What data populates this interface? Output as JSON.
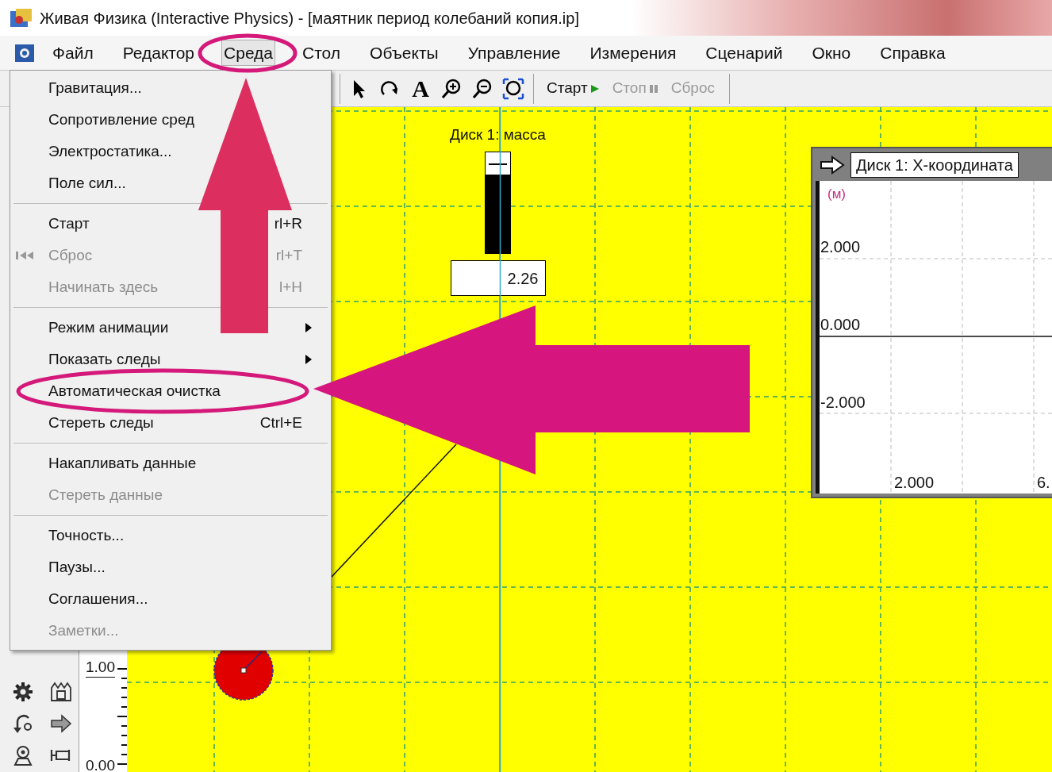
{
  "window": {
    "title": "Живая Физика (Interactive Physics) - [маятник период колебаний копия.ip]"
  },
  "menu_bar": [
    {
      "label": "Файл",
      "selected": false
    },
    {
      "label": "Редактор",
      "selected": false
    },
    {
      "label": "Среда",
      "selected": true
    },
    {
      "label": "Стол",
      "selected": false
    },
    {
      "label": "Объекты",
      "selected": false
    },
    {
      "label": "Управление",
      "selected": false
    },
    {
      "label": "Измерения",
      "selected": false
    },
    {
      "label": "Сценарий",
      "selected": false
    },
    {
      "label": "Окно",
      "selected": false
    },
    {
      "label": "Справка",
      "selected": false
    }
  ],
  "toolbar": {
    "tools": [
      {
        "kind": "arrow"
      },
      {
        "kind": "rotate"
      },
      {
        "kind": "text",
        "glyph": "A"
      },
      {
        "kind": "zoom-in"
      },
      {
        "kind": "zoom-out"
      },
      {
        "kind": "zoom-fit"
      }
    ],
    "run_buttons": [
      {
        "label": "Старт",
        "kind": "start",
        "disabled": false
      },
      {
        "label": "Стоп",
        "kind": "stop",
        "disabled": true
      },
      {
        "label": "Сброс",
        "kind": "reset",
        "disabled": true
      }
    ]
  },
  "dropdown": {
    "groups": [
      [
        {
          "label": "Гравитация...",
          "disabled": false
        },
        {
          "label": "Сопротивление сред",
          "disabled": false
        },
        {
          "label": "Электростатика...",
          "disabled": false
        },
        {
          "label": "Поле сил...",
          "disabled": false
        }
      ],
      [
        {
          "label": "Старт",
          "shortcut": "rl+R",
          "disabled": false
        },
        {
          "label": "Сброс",
          "shortcut": "rl+T",
          "disabled": true
        },
        {
          "label": "Начинать здесь",
          "shortcut": "l+H",
          "disabled": true
        }
      ],
      [
        {
          "label": "Режим анимации",
          "disabled": false,
          "submenu": true
        },
        {
          "label": "Показать следы",
          "disabled": false,
          "submenu": true
        },
        {
          "label": "Автоматическая очистка",
          "disabled": false
        },
        {
          "label": "Стереть следы",
          "shortcut": "Ctrl+E",
          "disabled": false
        }
      ],
      [
        {
          "label": "Накапливать данные",
          "disabled": false
        },
        {
          "label": "Стереть данные",
          "disabled": true
        }
      ],
      [
        {
          "label": "Точность...",
          "disabled": false
        },
        {
          "label": "Паузы...",
          "disabled": false
        },
        {
          "label": "Соглашения...",
          "disabled": false
        },
        {
          "label": "Заметки...",
          "disabled": true
        }
      ]
    ]
  },
  "palette": {
    "tools": [
      {
        "kind": "gear"
      },
      {
        "kind": "pulley"
      },
      {
        "kind": "curved-arrow"
      },
      {
        "kind": "arrow"
      },
      {
        "kind": "person"
      },
      {
        "kind": "damper"
      }
    ]
  },
  "ruler": {
    "labels": [
      "1.00",
      "0.00"
    ]
  },
  "slider": {
    "label": "Диск 1: масса",
    "level": 0.78,
    "value": "2.26"
  },
  "graph": {
    "title": "Диск 1: X-координата",
    "unit": "(м)",
    "y_ticks": [
      "2.000",
      "0.000",
      "-2.000"
    ],
    "x_ticks": [
      "2.000",
      "6."
    ]
  },
  "annotations": [
    {
      "kind": "ellipse",
      "color": "#d4197a"
    },
    {
      "kind": "arrow",
      "color": "#dc2e5f"
    },
    {
      "kind": "ellipse",
      "color": "#d4197a"
    },
    {
      "kind": "arrow",
      "color": "#d6157e"
    }
  ]
}
